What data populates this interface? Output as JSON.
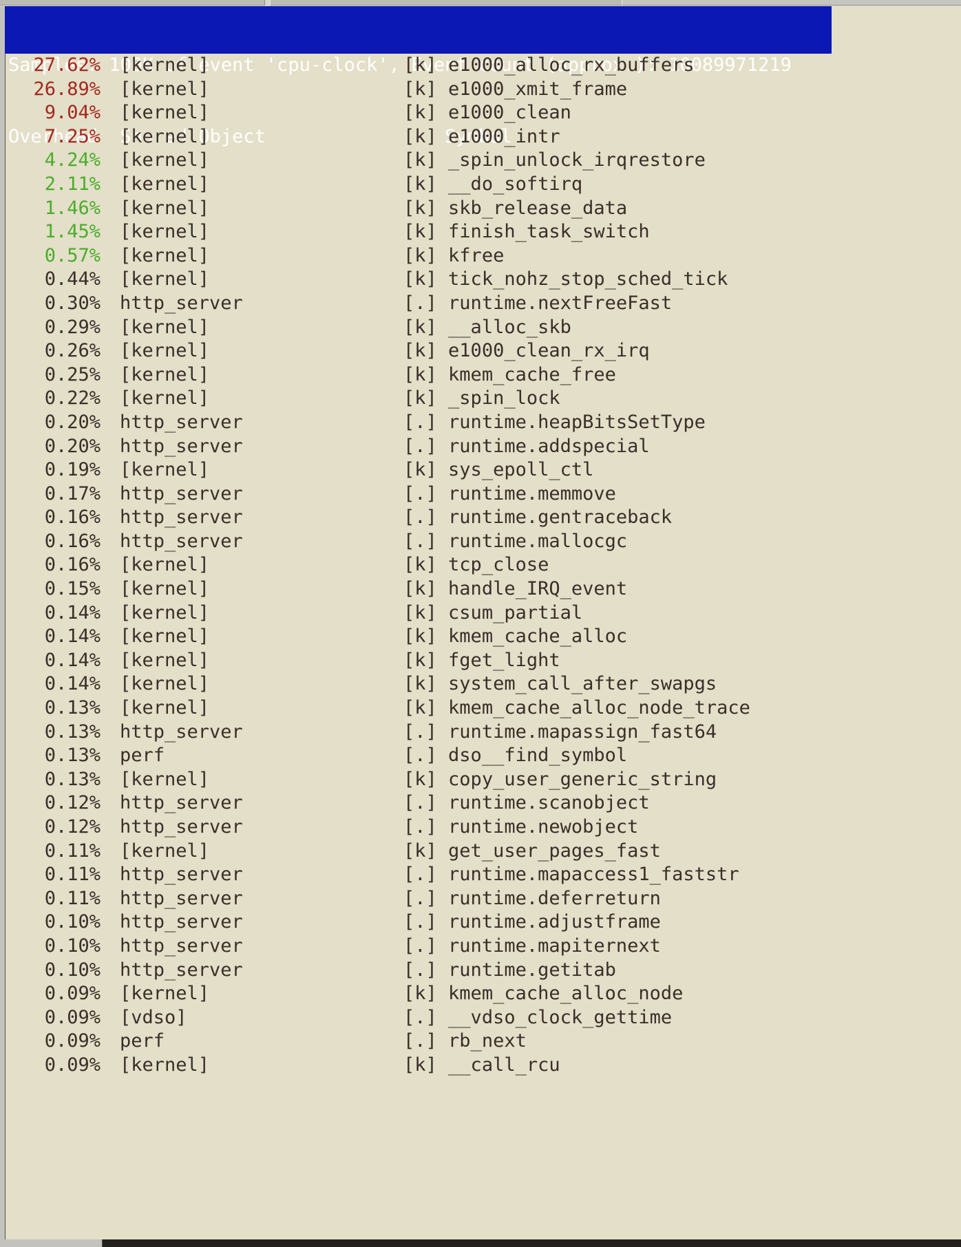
{
  "window": {
    "chrome_tabs": [
      "",
      "",
      ""
    ]
  },
  "header": {
    "samples_line": "Samples: 100K of event 'cpu-clock', Event count (approx.): 10089971219",
    "columns_line": "Overhead  Shared Object                Symbol",
    "columns": {
      "overhead": "Overhead",
      "shared_object": "Shared Object",
      "symbol": "Symbol"
    },
    "samples": "100K",
    "event": "cpu-clock",
    "event_count": "10089971219",
    "bg_color": "#0b18b4",
    "fg_color": "#ffffff"
  },
  "colors": {
    "background": "#e3dfc8",
    "text": "#3b2e2a",
    "high": "#a4281e",
    "medium": "#4aad2b",
    "normal": "#3b2e2a"
  },
  "rows": [
    {
      "overhead": "27.62%",
      "dso": "[kernel]",
      "tag": "[k]",
      "symbol": "e1000_alloc_rx_buffers",
      "level": "red"
    },
    {
      "overhead": "26.89%",
      "dso": "[kernel]",
      "tag": "[k]",
      "symbol": "e1000_xmit_frame",
      "level": "red"
    },
    {
      "overhead": "9.04%",
      "dso": "[kernel]",
      "tag": "[k]",
      "symbol": "e1000_clean",
      "level": "red"
    },
    {
      "overhead": "7.25%",
      "dso": "[kernel]",
      "tag": "[k]",
      "symbol": "e1000_intr",
      "level": "red"
    },
    {
      "overhead": "4.24%",
      "dso": "[kernel]",
      "tag": "[k]",
      "symbol": "_spin_unlock_irqrestore",
      "level": "green"
    },
    {
      "overhead": "2.11%",
      "dso": "[kernel]",
      "tag": "[k]",
      "symbol": "__do_softirq",
      "level": "green"
    },
    {
      "overhead": "1.46%",
      "dso": "[kernel]",
      "tag": "[k]",
      "symbol": "skb_release_data",
      "level": "green"
    },
    {
      "overhead": "1.45%",
      "dso": "[kernel]",
      "tag": "[k]",
      "symbol": "finish_task_switch",
      "level": "green"
    },
    {
      "overhead": "0.57%",
      "dso": "[kernel]",
      "tag": "[k]",
      "symbol": "kfree",
      "level": "green"
    },
    {
      "overhead": "0.44%",
      "dso": "[kernel]",
      "tag": "[k]",
      "symbol": "tick_nohz_stop_sched_tick",
      "level": "dark"
    },
    {
      "overhead": "0.30%",
      "dso": "http_server",
      "tag": "[.]",
      "symbol": "runtime.nextFreeFast",
      "level": "dark"
    },
    {
      "overhead": "0.29%",
      "dso": "[kernel]",
      "tag": "[k]",
      "symbol": "__alloc_skb",
      "level": "dark"
    },
    {
      "overhead": "0.26%",
      "dso": "[kernel]",
      "tag": "[k]",
      "symbol": "e1000_clean_rx_irq",
      "level": "dark"
    },
    {
      "overhead": "0.25%",
      "dso": "[kernel]",
      "tag": "[k]",
      "symbol": "kmem_cache_free",
      "level": "dark"
    },
    {
      "overhead": "0.22%",
      "dso": "[kernel]",
      "tag": "[k]",
      "symbol": "_spin_lock",
      "level": "dark"
    },
    {
      "overhead": "0.20%",
      "dso": "http_server",
      "tag": "[.]",
      "symbol": "runtime.heapBitsSetType",
      "level": "dark"
    },
    {
      "overhead": "0.20%",
      "dso": "http_server",
      "tag": "[.]",
      "symbol": "runtime.addspecial",
      "level": "dark"
    },
    {
      "overhead": "0.19%",
      "dso": "[kernel]",
      "tag": "[k]",
      "symbol": "sys_epoll_ctl",
      "level": "dark"
    },
    {
      "overhead": "0.17%",
      "dso": "http_server",
      "tag": "[.]",
      "symbol": "runtime.memmove",
      "level": "dark"
    },
    {
      "overhead": "0.16%",
      "dso": "http_server",
      "tag": "[.]",
      "symbol": "runtime.gentraceback",
      "level": "dark"
    },
    {
      "overhead": "0.16%",
      "dso": "http_server",
      "tag": "[.]",
      "symbol": "runtime.mallocgc",
      "level": "dark"
    },
    {
      "overhead": "0.16%",
      "dso": "[kernel]",
      "tag": "[k]",
      "symbol": "tcp_close",
      "level": "dark"
    },
    {
      "overhead": "0.15%",
      "dso": "[kernel]",
      "tag": "[k]",
      "symbol": "handle_IRQ_event",
      "level": "dark"
    },
    {
      "overhead": "0.14%",
      "dso": "[kernel]",
      "tag": "[k]",
      "symbol": "csum_partial",
      "level": "dark"
    },
    {
      "overhead": "0.14%",
      "dso": "[kernel]",
      "tag": "[k]",
      "symbol": "kmem_cache_alloc",
      "level": "dark"
    },
    {
      "overhead": "0.14%",
      "dso": "[kernel]",
      "tag": "[k]",
      "symbol": "fget_light",
      "level": "dark"
    },
    {
      "overhead": "0.14%",
      "dso": "[kernel]",
      "tag": "[k]",
      "symbol": "system_call_after_swapgs",
      "level": "dark"
    },
    {
      "overhead": "0.13%",
      "dso": "[kernel]",
      "tag": "[k]",
      "symbol": "kmem_cache_alloc_node_trace",
      "level": "dark"
    },
    {
      "overhead": "0.13%",
      "dso": "http_server",
      "tag": "[.]",
      "symbol": "runtime.mapassign_fast64",
      "level": "dark"
    },
    {
      "overhead": "0.13%",
      "dso": "perf",
      "tag": "[.]",
      "symbol": "dso__find_symbol",
      "level": "dark"
    },
    {
      "overhead": "0.13%",
      "dso": "[kernel]",
      "tag": "[k]",
      "symbol": "copy_user_generic_string",
      "level": "dark"
    },
    {
      "overhead": "0.12%",
      "dso": "http_server",
      "tag": "[.]",
      "symbol": "runtime.scanobject",
      "level": "dark"
    },
    {
      "overhead": "0.12%",
      "dso": "http_server",
      "tag": "[.]",
      "symbol": "runtime.newobject",
      "level": "dark"
    },
    {
      "overhead": "0.11%",
      "dso": "[kernel]",
      "tag": "[k]",
      "symbol": "get_user_pages_fast",
      "level": "dark"
    },
    {
      "overhead": "0.11%",
      "dso": "http_server",
      "tag": "[.]",
      "symbol": "runtime.mapaccess1_faststr",
      "level": "dark"
    },
    {
      "overhead": "0.11%",
      "dso": "http_server",
      "tag": "[.]",
      "symbol": "runtime.deferreturn",
      "level": "dark"
    },
    {
      "overhead": "0.10%",
      "dso": "http_server",
      "tag": "[.]",
      "symbol": "runtime.adjustframe",
      "level": "dark"
    },
    {
      "overhead": "0.10%",
      "dso": "http_server",
      "tag": "[.]",
      "symbol": "runtime.mapiternext",
      "level": "dark"
    },
    {
      "overhead": "0.10%",
      "dso": "http_server",
      "tag": "[.]",
      "symbol": "runtime.getitab",
      "level": "dark"
    },
    {
      "overhead": "0.09%",
      "dso": "[kernel]",
      "tag": "[k]",
      "symbol": "kmem_cache_alloc_node",
      "level": "dark"
    },
    {
      "overhead": "0.09%",
      "dso": "[vdso]",
      "tag": "[.]",
      "symbol": "__vdso_clock_gettime",
      "level": "dark"
    },
    {
      "overhead": "0.09%",
      "dso": "perf",
      "tag": "[.]",
      "symbol": "rb_next",
      "level": "dark"
    },
    {
      "overhead": "0.09%",
      "dso": "[kernel]",
      "tag": "[k]",
      "symbol": "__call_rcu",
      "level": "dark"
    }
  ]
}
